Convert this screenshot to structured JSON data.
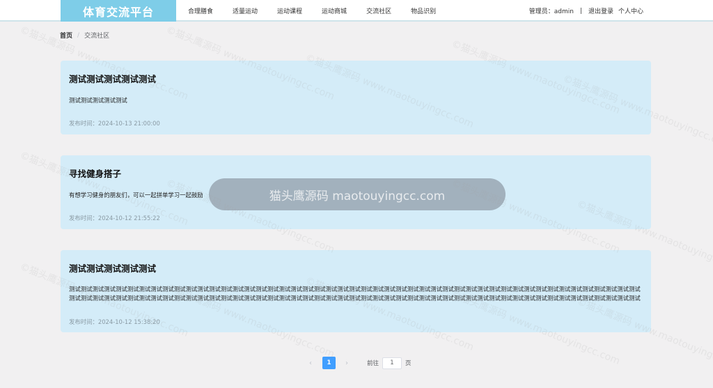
{
  "header": {
    "logo": "体育交流平台",
    "nav": [
      "合理膳食",
      "适量运动",
      "运动课程",
      "运动商城",
      "交流社区",
      "物品识别"
    ],
    "admin_label": "管理员：admin",
    "divider": "|",
    "logout": "退出登录",
    "profile": "个人中心"
  },
  "breadcrumb": {
    "home": "首页",
    "separator": "/",
    "current": "交流社区"
  },
  "posts": [
    {
      "title": "测试测试测试测试测试",
      "content": "测试测试测试测试测试",
      "time": "发布时间：2024-10-13 21:00:00"
    },
    {
      "title": "寻找健身搭子",
      "content": "有想学习健身的朋友们，可以一起拼单学习一起鼓励",
      "time": "发布时间：2024-10-12 21:55:22"
    },
    {
      "title": "测试测试测试测试测试",
      "content": "测试测试测试测试测试测试测试测试测试测试测试测试测试测试测试测试测试测试测试测试测试测试测试测试测试测试测试测试测试测试测试测试测试测试测试测试测试测试测试测试测试测试测试测试测试测试测试测试测试测试测试测试测试测试测试测试测试测试测试测试测试测试测试测试测试测试测试测试测试测试测试测试测试测试测试测试测试测试测试测试测试测试测试测试测试测试测试测试测试测试测试测试测试测试测试测试测试测试测试测试测试测试测试测试测试测试测试测试测试测试测试测试测试测试测试测试测试测试测试测试测试测试测试测试测试测试测试测试测试测试测试测试测试测试测试测试测试测试测试测试测试测试测试测试测试测试测试测试测试测试测试测试测试测试测试测试测试测试测试测试测试测试测试测试测试测试测试测试测试测试测试测试测试测试测试测试测试测试测试测试测试测试测试测试测试测试测试测试测试测试测试",
      "time": "发布时间：2024-10-12 15:38:20"
    }
  ],
  "pagination": {
    "prev_icon": "‹",
    "current_page": "1",
    "next_icon": "›",
    "goto_label": "前往",
    "goto_value": "1",
    "page_suffix": "页"
  },
  "watermark": {
    "pill_text": "猫头鹰源码 maotouyingcc.com",
    "repeat_text": "©猫头鹰源码 www.maotouyingcc.com"
  }
}
